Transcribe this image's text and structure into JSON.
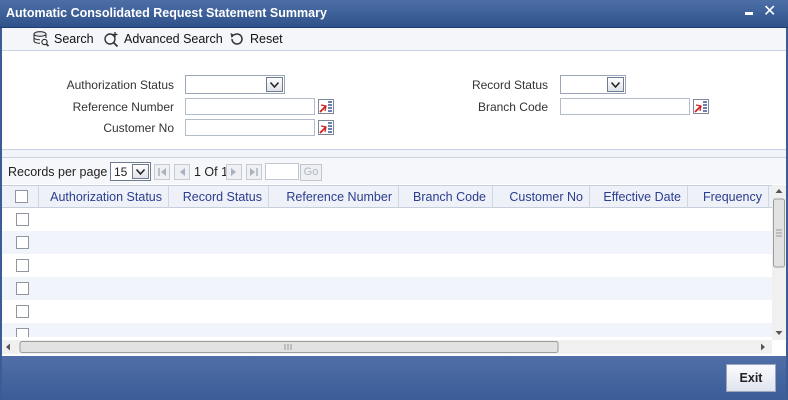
{
  "window": {
    "title": "Automatic Consolidated Request Statement Summary"
  },
  "toolbar": {
    "search_label": "Search",
    "advanced_search_label": "Advanced Search",
    "reset_label": "Reset"
  },
  "search_form": {
    "authorization_status_label": "Authorization Status",
    "authorization_status_value": "",
    "reference_number_label": "Reference Number",
    "reference_number_value": "",
    "customer_no_label": "Customer No",
    "customer_no_value": "",
    "record_status_label": "Record Status",
    "record_status_value": "",
    "branch_code_label": "Branch Code",
    "branch_code_value": ""
  },
  "pager": {
    "records_per_page_label": "Records per page",
    "records_per_page_value": "15",
    "page_info": "1 Of 1",
    "go_label": "Go"
  },
  "table": {
    "columns": [
      "Authorization Status",
      "Record Status",
      "Reference Number",
      "Branch Code",
      "Customer No",
      "Effective Date",
      "Frequency"
    ],
    "rows": [
      [],
      [],
      [],
      [],
      [],
      []
    ]
  },
  "footer": {
    "exit_label": "Exit"
  },
  "colors": {
    "titlebar": "#3b5d96",
    "header_text": "#2a3d8f",
    "alt_row": "#f1f4fa"
  }
}
